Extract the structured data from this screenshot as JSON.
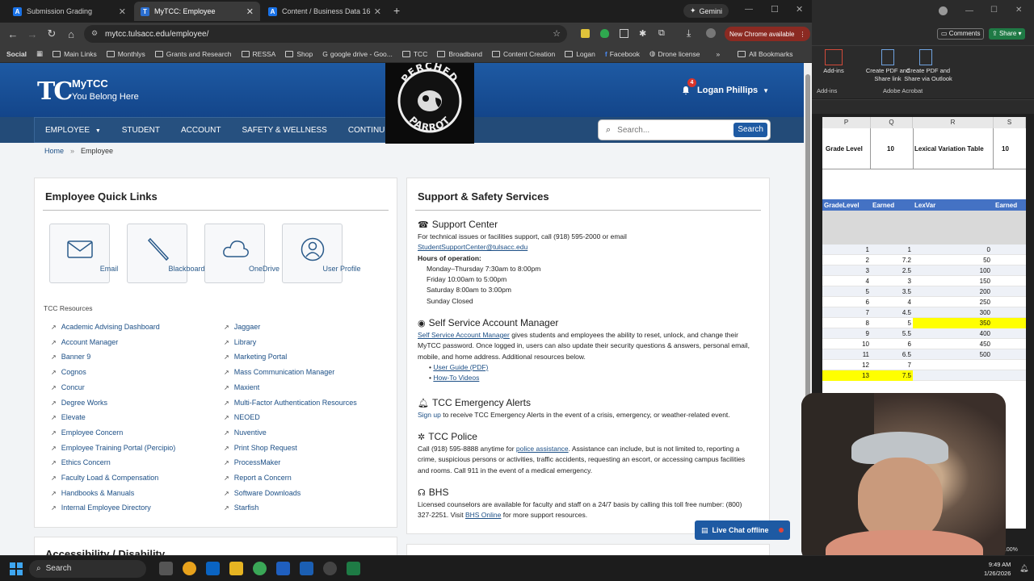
{
  "tabs": [
    {
      "label": "Submission Grading",
      "active": false
    },
    {
      "label": "MyTCC: Employee",
      "active": true
    },
    {
      "label": "Content / Business Data 16 We",
      "active": false
    }
  ],
  "gemini_label": "Gemini",
  "address": "mytcc.tulsacc.edu/employee/",
  "new_chrome": "New Chrome available",
  "bookmarks": [
    "Social",
    "Main Links",
    "Monthlys",
    "Grants and Research",
    "RESSA",
    "Shop",
    "google drive - Goo...",
    "TCC",
    "Broadband",
    "Content Creation",
    "Logan",
    "Facebook",
    "Drone license"
  ],
  "all_bookmarks": "All Bookmarks",
  "header": {
    "logo": "TC",
    "title": "MyTCC",
    "tagline": "You Belong Here",
    "notifications": "4",
    "user_name": "Logan Phillips"
  },
  "nav": [
    "EMPLOYEE",
    "STUDENT",
    "ACCOUNT",
    "SAFETY & WELLNESS",
    "CONTINUING EDU"
  ],
  "overlay": {
    "top": "PERCHED",
    "bottom": "PARROT"
  },
  "search": {
    "placeholder": "Search...",
    "button": "Search"
  },
  "breadcrumb": {
    "home": "Home",
    "current": "Employee"
  },
  "quick_links": {
    "title": "Employee Quick Links",
    "tiles": [
      "Email",
      "Blackboard",
      "OneDrive",
      "User Profile"
    ],
    "resources_title": "TCC Resources",
    "left": [
      "Academic Advising Dashboard",
      "Account Manager",
      "Banner 9",
      "Cognos",
      "Concur",
      "Degree Works",
      "Elevate",
      "Employee Concern",
      "Employee Training Portal (Percipio)",
      "Ethics Concern",
      "Faculty Load & Compensation",
      "Handbooks & Manuals",
      "Internal Employee Directory"
    ],
    "right": [
      "Jaggaer",
      "Library",
      "Marketing Portal",
      "Mass Communication Manager",
      "Maxient",
      "Multi-Factor Authentication Resources",
      "NEOED",
      "Nuventive",
      "Print Shop Request",
      "ProcessMaker",
      "Report a Concern",
      "Software Downloads",
      "Starfish"
    ]
  },
  "accessibility_title": "Accessibility / Disability",
  "support": {
    "title": "Support & Safety Services",
    "center_title": "Support Center",
    "center_text": "For technical issues or facilities support, call (918) 595-2000 or email",
    "center_email": "StudentSupportCenter@tulsacc.edu",
    "hours_label": "Hours of operation:",
    "hours": [
      "Monday–Thursday 7:30am to 8:00pm",
      "Friday 10:00am to 5:00pm",
      "Saturday 8:00am to 3:00pm",
      "Sunday Closed"
    ],
    "ssam_title": "Self Service Account Manager",
    "ssam_link": "Self Service Account Manager",
    "ssam_text": "gives students and employees the ability to reset, unlock, and change their MyTCC password. Once logged in, users can also update their security questions & answers, personal email, mobile, and home address. Additional resources below.",
    "ssam_links": [
      "User Guide (PDF)",
      "How-To Videos"
    ],
    "alerts_title": "TCC Emergency Alerts",
    "alerts_link": "Sign up",
    "alerts_text": "to receive TCC Emergency Alerts in the event of a crisis, emergency, or weather-related event.",
    "police_title": "TCC Police",
    "police_text1": "Call (918) 595-8888 anytime for",
    "police_link": "police assistance",
    "police_text2": ". Assistance can include, but is not limited to, reporting a crime, suspicious persons or activities, traffic accidents, requesting an escort, or accessing campus facilities and rooms. Call 911 in the event of a medical emergency.",
    "bhs_title": "BHS",
    "bhs_text": "Licensed counselors are available for faculty and staff on a 24/7 basis by calling this toll free number: (800) 327-2251. Visit",
    "bhs_link": "BHS Online",
    "bhs_text2": "for more support resources."
  },
  "live_chat": "Live Chat offline",
  "taskbar": {
    "search": "Search",
    "time": "9:49 AM",
    "date": "1/26/2026"
  },
  "excel": {
    "comments": "Comments",
    "share": "Share",
    "addins_btn": "Add-ins",
    "pdf1": "Create PDF and Share link",
    "pdf2": "Create PDF and Share via Outlook",
    "group_addins": "Add-ins",
    "group_acrobat": "Adobe Acrobat",
    "columns": [
      "P",
      "Q",
      "R",
      "S"
    ],
    "header_row": [
      "Grade Level",
      "10",
      "Lexical Variation Table",
      "10"
    ],
    "table_headers": [
      "GradeLevel",
      "Earned",
      "LexVar",
      "Earned"
    ],
    "rows": [
      [
        "1",
        "1",
        "0"
      ],
      [
        "2",
        "7.2",
        "50"
      ],
      [
        "3",
        "2.5",
        "100"
      ],
      [
        "4",
        "3",
        "150"
      ],
      [
        "5",
        "3.5",
        "200"
      ],
      [
        "6",
        "4",
        "250"
      ],
      [
        "7",
        "4.5",
        "300"
      ],
      [
        "8",
        "5",
        "350"
      ],
      [
        "9",
        "5.5",
        "400"
      ],
      [
        "10",
        "6",
        "450"
      ],
      [
        "11",
        "6.5",
        "500"
      ],
      [
        "12",
        "7",
        ""
      ],
      [
        "13",
        "7.5",
        ""
      ]
    ],
    "zoom": "100%"
  }
}
